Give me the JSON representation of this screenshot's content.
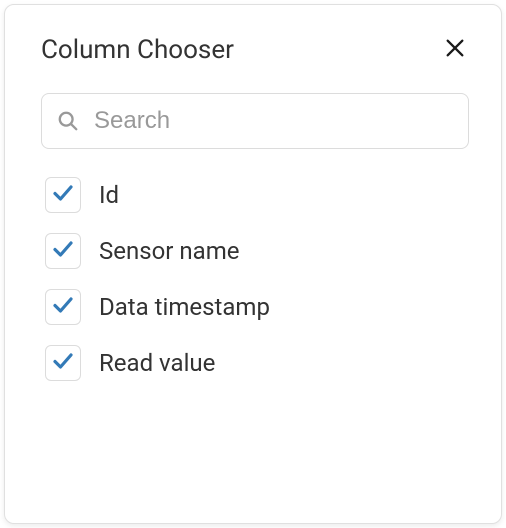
{
  "dialog": {
    "title": "Column Chooser"
  },
  "search": {
    "placeholder": "Search",
    "value": ""
  },
  "columns": [
    {
      "label": "Id",
      "checked": true
    },
    {
      "label": "Sensor name",
      "checked": true
    },
    {
      "label": "Data timestamp",
      "checked": true
    },
    {
      "label": "Read value",
      "checked": true
    }
  ],
  "colors": {
    "check": "#337ab7",
    "icon": "#999999",
    "close": "#1a1a1a"
  }
}
